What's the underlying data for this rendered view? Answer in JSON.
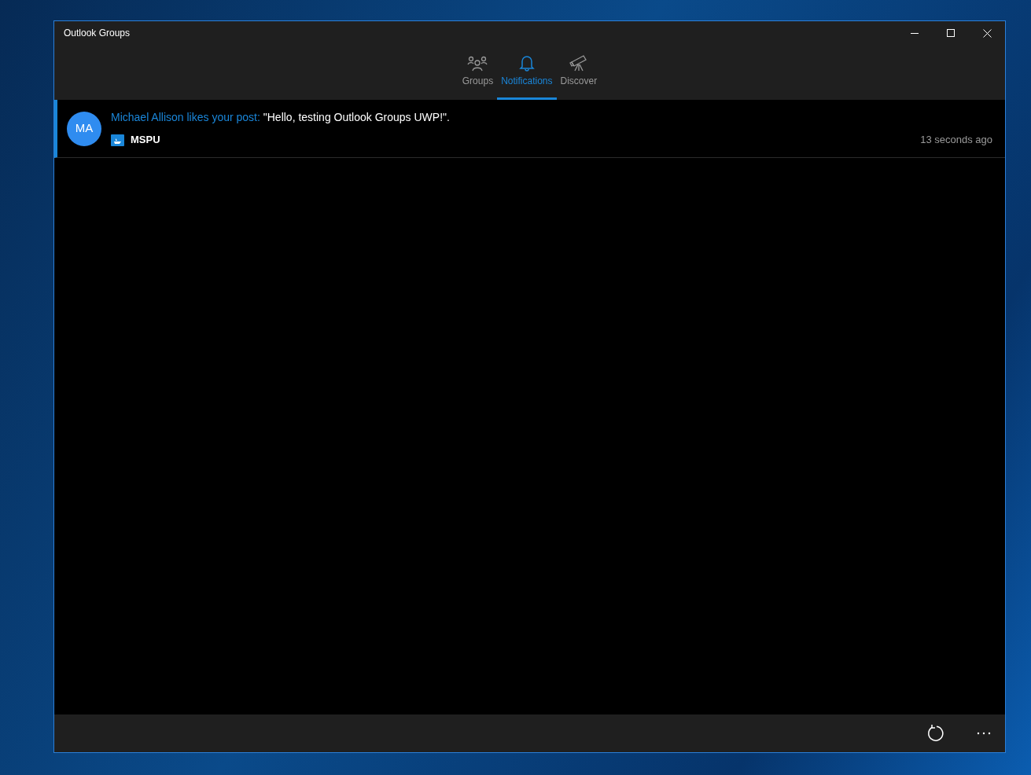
{
  "window": {
    "title": "Outlook Groups"
  },
  "tabs": [
    {
      "label": "Groups",
      "selected": false
    },
    {
      "label": "Notifications",
      "selected": true
    },
    {
      "label": "Discover",
      "selected": false
    }
  ],
  "notifications": [
    {
      "avatar": "MA",
      "author": "Michael Allison",
      "action": "likes your post:",
      "message": "\"Hello, testing Outlook Groups UWP!\".",
      "group": "MSPU",
      "time": "13 seconds ago",
      "unread": true
    }
  ]
}
